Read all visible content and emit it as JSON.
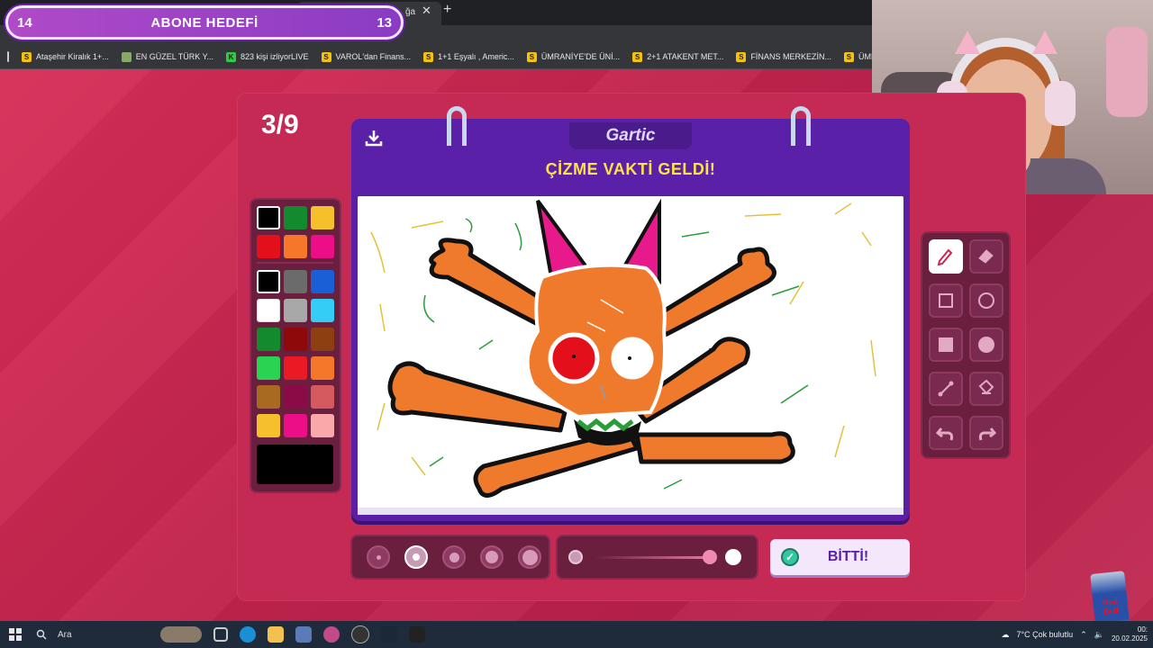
{
  "browser": {
    "tab_partial_text": "ğa",
    "tab_close": "✕",
    "new_tab": "+",
    "bookmarks": [
      {
        "label": "Ataşehir Kiralık 1+...",
        "icon": "S"
      },
      {
        "label": "EN GÜZEL TÜRK Y...",
        "icon": "img"
      },
      {
        "label": "823 kişi izliyorLIVE",
        "icon": "K"
      },
      {
        "label": "VAROL'dan Finans...",
        "icon": "S"
      },
      {
        "label": "1+1 Eşyalı , Americ...",
        "icon": "S"
      },
      {
        "label": "ÜMRANİYE'DE ÜNİ...",
        "icon": "S"
      },
      {
        "label": "2+1 ATAKENT MET...",
        "icon": "S"
      },
      {
        "label": "FİNANS MERKEZİN...",
        "icon": "S"
      },
      {
        "label": "ÜMRANİYE ARMA...",
        "icon": "S"
      },
      {
        "label": "",
        "icon": "S"
      }
    ]
  },
  "goal": {
    "left_value": "14",
    "title": "ABONE HEDEFİ",
    "right_value": "13"
  },
  "game": {
    "round_counter": "3/9",
    "logo": "Gartic",
    "prompt": "ÇİZME VAKTİ GELDİ!",
    "done_label": "BİTTİ!",
    "palette": [
      [
        "#000000",
        "#138a2e",
        "#f5c02c"
      ],
      [
        "#e3101c",
        "#f4772a",
        "#ec0e86"
      ],
      [
        "#000000",
        "#6b6b6b",
        "#1b5fd6"
      ],
      [
        "#ffffff",
        "#a8a8a8",
        "#33cdf5"
      ],
      [
        "#138a2e",
        "#8e0a0a",
        "#8e3f12"
      ],
      [
        "#2ad352",
        "#ea1a25",
        "#f4772a"
      ],
      [
        "#a86a20",
        "#8a0b45",
        "#d45a60"
      ],
      [
        "#f5c02c",
        "#ec0e86",
        "#f9a9a9"
      ]
    ],
    "selected_color": "#000000",
    "tools": [
      "pencil-icon",
      "eraser-icon",
      "square-outline-icon",
      "circle-outline-icon",
      "square-filled-icon",
      "circle-filled-icon",
      "line-icon",
      "fill-bucket-icon",
      "undo-icon",
      "redo-icon"
    ],
    "active_tool": "pencil-icon",
    "brush_sizes": [
      1,
      2,
      3,
      4,
      5
    ],
    "selected_brush": 2,
    "opacity_level": 0.9
  },
  "taskbar": {
    "search_placeholder": "Ara",
    "weather": "7°C  Çok bulutlu",
    "time": "00:",
    "date": "20.02.2025"
  },
  "can_label": "Red Bull",
  "colors": {
    "accent_purple": "#5a21a8",
    "prompt_yellow": "#ffe14a",
    "panel_pink": "#c52a55"
  }
}
